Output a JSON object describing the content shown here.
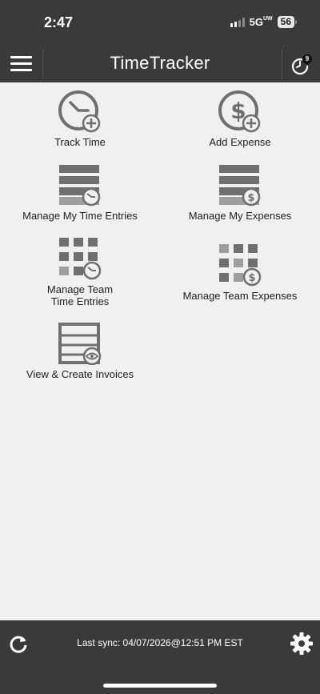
{
  "status_bar": {
    "time": "2:47",
    "network": "5G",
    "network_suffix": "UW",
    "battery": "56"
  },
  "header": {
    "app_title": "TimeTracker",
    "menu_icon": "hamburger-icon",
    "history_icon": "clock-history-icon",
    "history_badge": "9"
  },
  "tiles": [
    {
      "label": "Track Time",
      "icon": "clock-plus-icon"
    },
    {
      "label": "Add Expense",
      "icon": "dollar-plus-icon"
    },
    {
      "label": "Manage My Time Entries",
      "icon": "list-clock-icon"
    },
    {
      "label": "Manage My Expenses",
      "icon": "list-dollar-icon"
    },
    {
      "label_line1": "Manage Team",
      "label_line2": "Time Entries",
      "icon": "grid-clock-icon"
    },
    {
      "label": "Manage Team Expenses",
      "icon": "grid-dollar-icon"
    },
    {
      "label": "View & Create Invoices",
      "icon": "invoice-eye-icon"
    }
  ],
  "footer": {
    "sync_text": "Last sync: 04/07/2026@12:51 PM EST",
    "sync_icon": "refresh-icon",
    "settings_icon": "gear-icon"
  },
  "colors": {
    "header_bg": "#3a3a3a",
    "page_bg": "#f0f0f0",
    "icon_dark": "#6f6f6f",
    "icon_light": "#9e9e9e"
  }
}
